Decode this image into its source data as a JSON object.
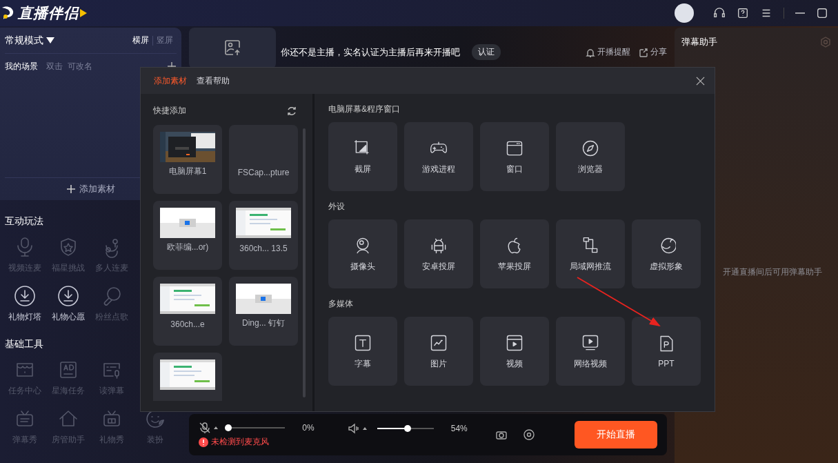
{
  "app": {
    "title": "直播伴侣"
  },
  "scene_panel": {
    "mode": "常规模式",
    "orientations": [
      {
        "label": "横屏",
        "selected": true
      },
      {
        "label": "竖屏",
        "selected": false
      }
    ],
    "scene_title": "我的场景",
    "hint": "双击  可改名",
    "add_button": "添加素材"
  },
  "interactive": {
    "title": "互动玩法",
    "rows": [
      [
        {
          "label": "视频连麦",
          "disabled": true
        },
        {
          "label": "福星挑战",
          "disabled": true
        },
        {
          "label": "多人连麦",
          "disabled": true
        }
      ],
      [
        {
          "label": "礼物灯塔",
          "disabled": false
        },
        {
          "label": "礼物心愿",
          "disabled": false
        },
        {
          "label": "粉丝点歌",
          "disabled": true
        }
      ]
    ]
  },
  "tools": {
    "title": "基础工具",
    "rows": [
      [
        {
          "label": "任务中心",
          "disabled": true
        },
        {
          "label": "星海任务",
          "disabled": true
        },
        {
          "label": "读弹幕",
          "disabled": true
        }
      ],
      [
        {
          "label": "弹幕秀",
          "disabled": true
        },
        {
          "label": "房管助手",
          "disabled": true
        },
        {
          "label": "礼物秀",
          "disabled": true
        },
        {
          "label": "装扮",
          "disabled": true
        }
      ]
    ]
  },
  "notice": {
    "text": "你还不是主播，实名认证为主播后再来开播吧",
    "button": "认证",
    "actions": [
      "开播提醒",
      "分享"
    ]
  },
  "danmu_panel": {
    "title": "弹幕助手",
    "message": "开通直播间后可用弹幕助手"
  },
  "dialog": {
    "tabs": [
      {
        "label": "添加素材",
        "selected": true
      },
      {
        "label": "查看帮助",
        "selected": false
      }
    ],
    "quick_add": {
      "title": "快捷添加",
      "items": [
        {
          "label": "电脑屏幕1",
          "kind": "picture"
        },
        {
          "label": "FSCap...pture"
        },
        {
          "label": "欧菲编...or)",
          "kind": "picture"
        },
        {
          "label": "360ch... 13.5",
          "kind": "picture"
        },
        {
          "label": "360ch...e",
          "kind": "picture"
        },
        {
          "label": "Ding...  钉钉",
          "kind": "picture"
        },
        {
          "kind": "picture"
        }
      ]
    },
    "sections": [
      {
        "title": "电脑屏幕&程序窗口",
        "items": [
          "截屏",
          "游戏进程",
          "窗口",
          "浏览器"
        ]
      },
      {
        "title": "外设",
        "items": [
          "摄像头",
          "安卓投屏",
          "苹果投屏",
          "局域网推流",
          "虚拟形象"
        ]
      },
      {
        "title": "多媒体",
        "items": [
          "字幕",
          "图片",
          "视频",
          "网络视频",
          "PPT"
        ]
      }
    ]
  },
  "bottom_bar": {
    "mic": {
      "level": 0,
      "reading": "0%",
      "warning": "未检测到麦克风"
    },
    "speaker": {
      "level": 0.54,
      "reading": "54%"
    },
    "start_button": "开始直播"
  }
}
